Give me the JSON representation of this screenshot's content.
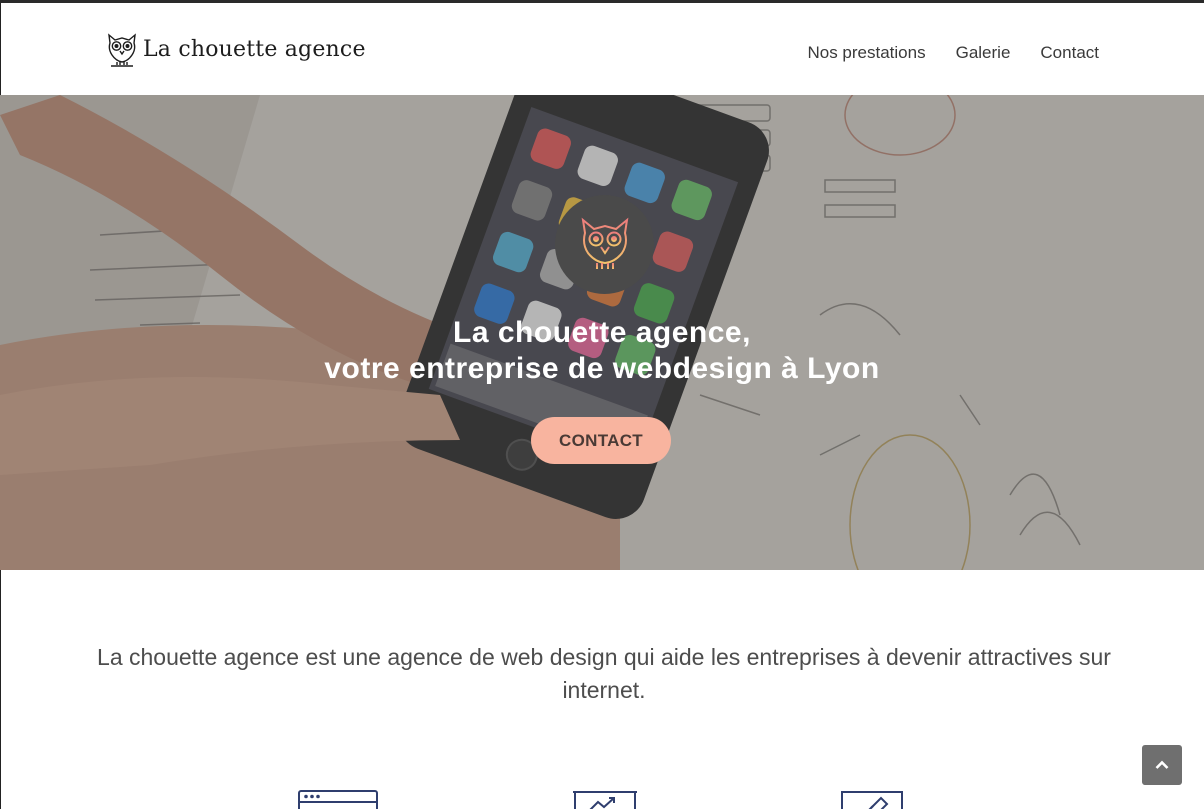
{
  "header": {
    "logo_text": "La chouette agence",
    "nav": [
      {
        "label": "Nos prestations"
      },
      {
        "label": "Galerie"
      },
      {
        "label": "Contact"
      }
    ]
  },
  "hero": {
    "title_line1": "La chouette agence,",
    "title_line2": "votre entreprise de webdesign à Lyon",
    "cta_label": "CONTACT",
    "badge_icon": "owl-icon"
  },
  "intro": {
    "text": "La chouette agence est une agence de web design qui aide les entreprises à devenir attractives sur internet."
  },
  "services": {
    "icons": [
      "browser-window-icon",
      "presentation-chart-icon",
      "image-edit-icon"
    ]
  },
  "scroll_top": {
    "icon": "chevron-up-icon"
  },
  "colors": {
    "accent": "#f8b49f",
    "badge": "#4a4a4a",
    "service_icon": "#2f3e6e",
    "text": "#4d4d4d"
  }
}
